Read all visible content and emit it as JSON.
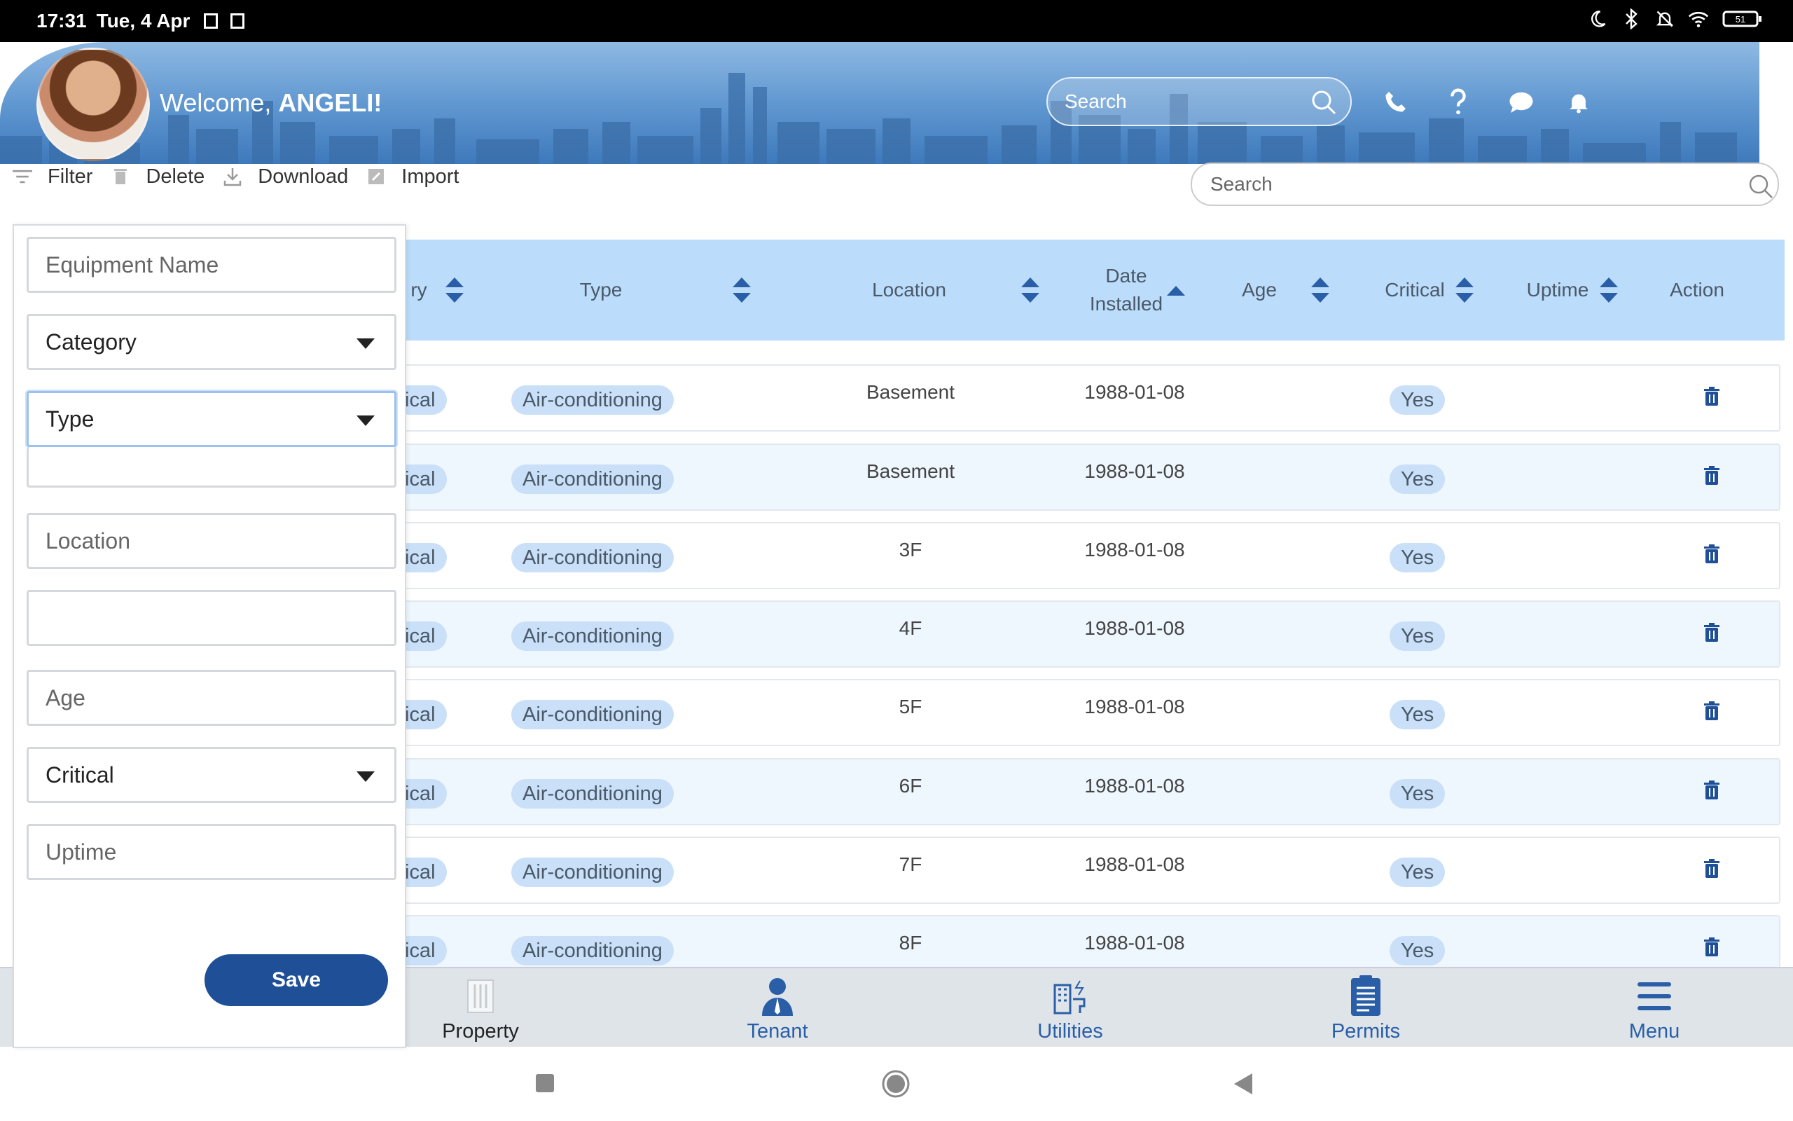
{
  "status_bar": {
    "time": "17:31",
    "date": "Tue, 4 Apr",
    "battery": "51"
  },
  "header": {
    "welcome_prefix": "Welcome, ",
    "user_name": "ANGELI!",
    "search_placeholder": "Search"
  },
  "toolbar": {
    "filter": "Filter",
    "delete": "Delete",
    "download": "Download",
    "import": "Import",
    "search_placeholder": "Search"
  },
  "table": {
    "columns": {
      "category_partial": "ry",
      "type": "Type",
      "location": "Location",
      "date_installed_1": "Date",
      "date_installed_2": "Installed",
      "age": "Age",
      "critical": "Critical",
      "uptime": "Uptime",
      "action": "Action"
    },
    "rows": [
      {
        "category": "ical",
        "type": "Air-conditioning",
        "location": "Basement",
        "date": "1988-01-08",
        "critical": "Yes"
      },
      {
        "category": "ical",
        "type": "Air-conditioning",
        "location": "Basement",
        "date": "1988-01-08",
        "critical": "Yes"
      },
      {
        "category": "ical",
        "type": "Air-conditioning",
        "location": "3F",
        "date": "1988-01-08",
        "critical": "Yes"
      },
      {
        "category": "ical",
        "type": "Air-conditioning",
        "location": "4F",
        "date": "1988-01-08",
        "critical": "Yes"
      },
      {
        "category": "ical",
        "type": "Air-conditioning",
        "location": "5F",
        "date": "1988-01-08",
        "critical": "Yes"
      },
      {
        "category": "ical",
        "type": "Air-conditioning",
        "location": "6F",
        "date": "1988-01-08",
        "critical": "Yes"
      },
      {
        "category": "ical",
        "type": "Air-conditioning",
        "location": "7F",
        "date": "1988-01-08",
        "critical": "Yes"
      },
      {
        "category": "ical",
        "type": "Air-conditioning",
        "location": "8F",
        "date": "1988-01-08",
        "critical": "Yes"
      }
    ]
  },
  "filter_panel": {
    "equipment_name_placeholder": "Equipment Name",
    "category_label": "Category",
    "type_label": "Type",
    "location_placeholder": "Location",
    "age_placeholder": "Age",
    "critical_label": "Critical",
    "uptime_placeholder": "Uptime",
    "save_label": "Save"
  },
  "bottom_nav": {
    "property": "Property",
    "tenant": "Tenant",
    "utilities": "Utilities",
    "permits": "Permits",
    "menu": "Menu"
  },
  "colors": {
    "accent": "#1f4f96",
    "header_blue": "#5d95cf",
    "table_header": "#bcdcfb",
    "pill": "#c9e0f8",
    "nav_blue": "#2a5fa7"
  }
}
